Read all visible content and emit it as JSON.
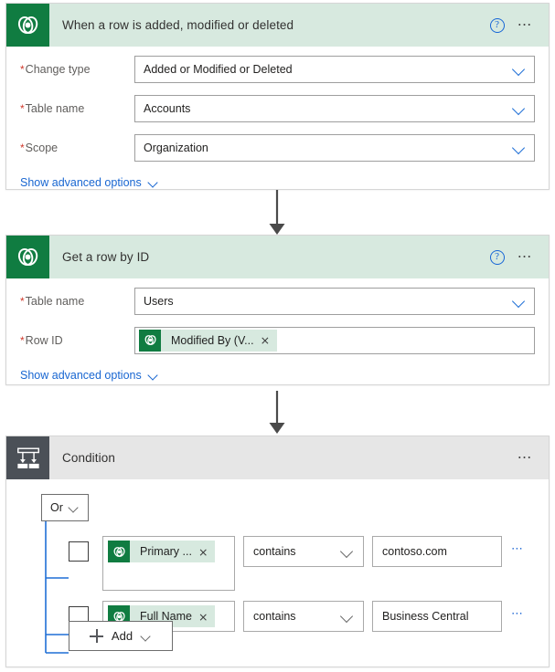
{
  "colors": {
    "connector_green_tile": "#107c41",
    "header_green": "#d7e9df",
    "header_gray": "#e6e6e6",
    "condition_tile": "#4b5057",
    "link_blue": "#1866d1",
    "required_red": "#d0392b",
    "tree_line_blue": "#1f6fd6"
  },
  "cards": [
    {
      "id": "trigger",
      "icon": "dataverse-icon",
      "title": "When a row is added, modified or deleted",
      "help_icon": "help-icon",
      "more_icon": "ellipsis-icon",
      "fields": [
        {
          "required": true,
          "label": "Change type",
          "value": "Added or Modified or Deleted",
          "control": "dropdown"
        },
        {
          "required": true,
          "label": "Table name",
          "value": "Accounts",
          "control": "dropdown"
        },
        {
          "required": true,
          "label": "Scope",
          "value": "Organization",
          "control": "dropdown"
        }
      ],
      "advanced_link": "Show advanced options"
    },
    {
      "id": "get-row",
      "icon": "dataverse-icon",
      "title": "Get a row by ID",
      "help_icon": "help-icon",
      "more_icon": "ellipsis-icon",
      "fields": [
        {
          "required": true,
          "label": "Table name",
          "value": "Users",
          "control": "dropdown"
        },
        {
          "required": true,
          "label": "Row ID",
          "control": "token",
          "token": {
            "icon": "dataverse-icon",
            "label": "Modified By (V...",
            "remove": "×"
          }
        }
      ],
      "advanced_link": "Show advanced options"
    },
    {
      "id": "condition",
      "icon": "condition-branch-icon",
      "title": "Condition",
      "more_icon": "ellipsis-icon"
    }
  ],
  "condition": {
    "group_operator": "Or",
    "rows": [
      {
        "checkbox_checked": false,
        "token": {
          "icon": "dataverse-icon",
          "label": "Primary ...",
          "remove": "×"
        },
        "operator": "contains",
        "value": "contoso.com",
        "more_icon": "ellipsis-icon"
      },
      {
        "checkbox_checked": false,
        "token": {
          "icon": "dataverse-icon",
          "label": "Full Name",
          "remove": "×"
        },
        "operator": "contains",
        "value": "Business Central",
        "more_icon": "ellipsis-icon"
      }
    ],
    "add_button": "Add"
  },
  "connectors": [
    {
      "from": "trigger",
      "to": "get-row",
      "icon": "down-arrow-icon"
    },
    {
      "from": "get-row",
      "to": "condition",
      "icon": "down-arrow-icon"
    }
  ]
}
